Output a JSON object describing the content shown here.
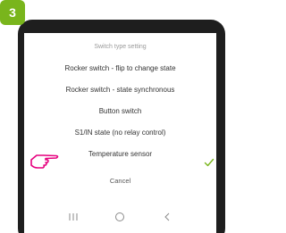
{
  "step_number": "3",
  "dialog": {
    "title": "Switch type setting",
    "options": [
      {
        "label": "Rocker switch - flip to change state",
        "selected": false
      },
      {
        "label": "Rocker switch - state synchronous",
        "selected": false
      },
      {
        "label": "Button switch",
        "selected": false
      },
      {
        "label": "S1/IN state (no relay control)",
        "selected": false
      },
      {
        "label": "Temperature sensor",
        "selected": true
      }
    ],
    "cancel_label": "Cancel"
  },
  "icons": {
    "pointer": "pointing-hand-icon",
    "selected": "check-icon",
    "nav_recent": "recent-apps-icon",
    "nav_home": "home-icon",
    "nav_back": "back-icon"
  },
  "colors": {
    "badge": "#79b51c",
    "pointer_hand": "#e6007e",
    "check": "#79b51c",
    "phone_frame": "#1e1e1e"
  }
}
